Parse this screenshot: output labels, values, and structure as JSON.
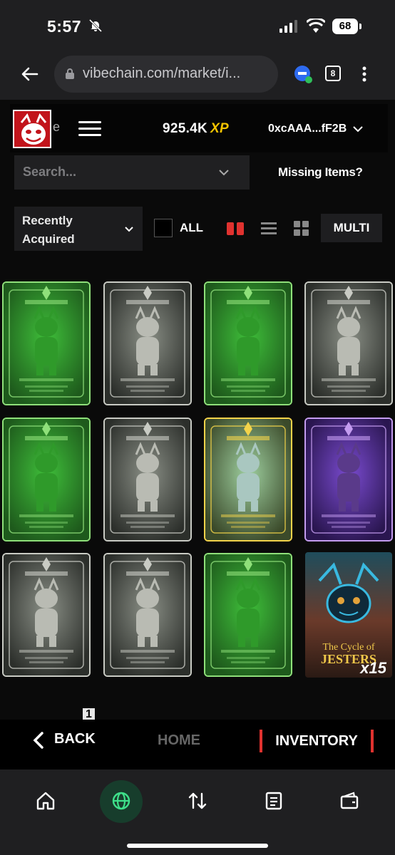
{
  "status": {
    "time": "5:57",
    "battery": "68"
  },
  "browser": {
    "url": "vibechain.com/market/i...",
    "tab_count": "8"
  },
  "header": {
    "logo_fragment": "e",
    "xp_value": "925.4K",
    "xp_unit": "XP",
    "wallet": "0xcAAA...fF2B"
  },
  "search": {
    "placeholder": "Search...",
    "missing_items": "Missing Items?"
  },
  "filters": {
    "sort_selected": "Recently Acquired",
    "all_label": "ALL",
    "multi_label": "MULTI"
  },
  "cards": [
    {
      "variant": "green"
    },
    {
      "variant": "silver"
    },
    {
      "variant": "green"
    },
    {
      "variant": "silver"
    },
    {
      "variant": "green"
    },
    {
      "variant": "silver"
    },
    {
      "variant": "holo"
    },
    {
      "variant": "purple"
    },
    {
      "variant": "silver"
    },
    {
      "variant": "silver"
    },
    {
      "variant": "green"
    }
  ],
  "pack": {
    "title_line1": "The Cycle of",
    "title_line2": "JESTERS",
    "count": "x15"
  },
  "pagination": {
    "current": "1"
  },
  "bottom_bar": {
    "back": "BACK",
    "home": "HOME",
    "inventory": "INVENTORY"
  },
  "colors": {
    "green": "#2fa233",
    "silver": "#8a8f86",
    "purple": "#6a3bb0",
    "accent_red": "#e0322f",
    "xp_gold": "#f5c400"
  }
}
